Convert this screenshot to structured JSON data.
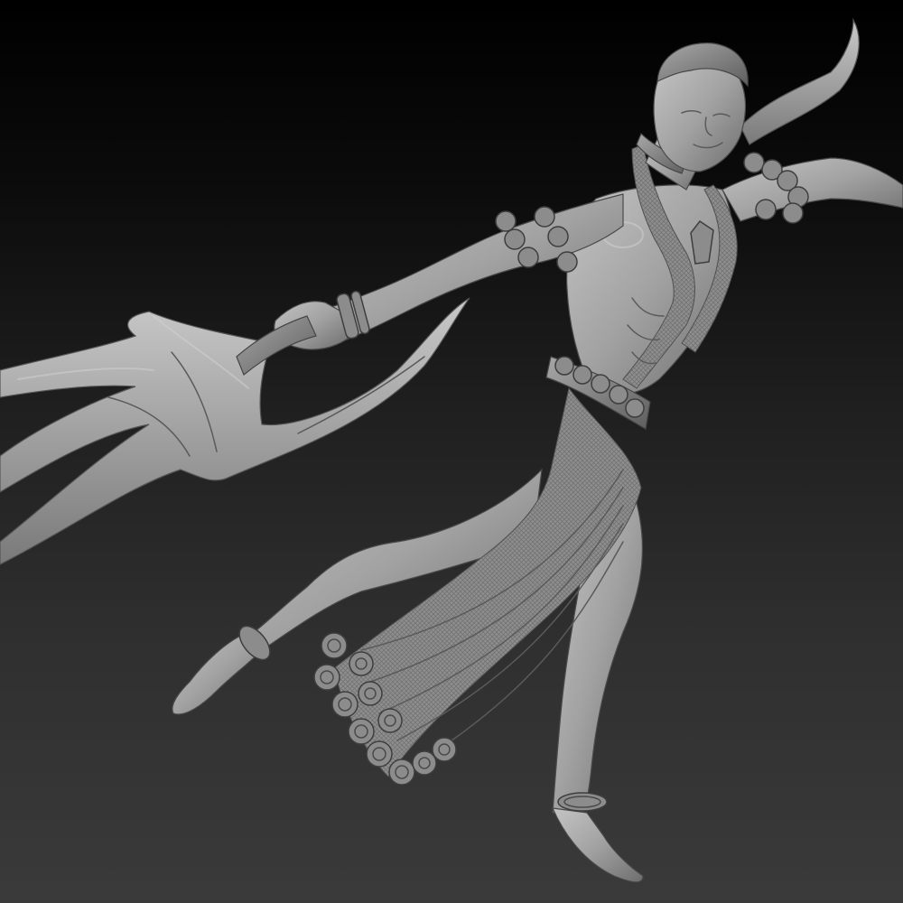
{
  "scene": {
    "background_top": "#000000",
    "background_bottom": "#3a3a3a",
    "material_color": "#9a9a9a"
  },
  "figure": {
    "pose": "leaping"
  }
}
